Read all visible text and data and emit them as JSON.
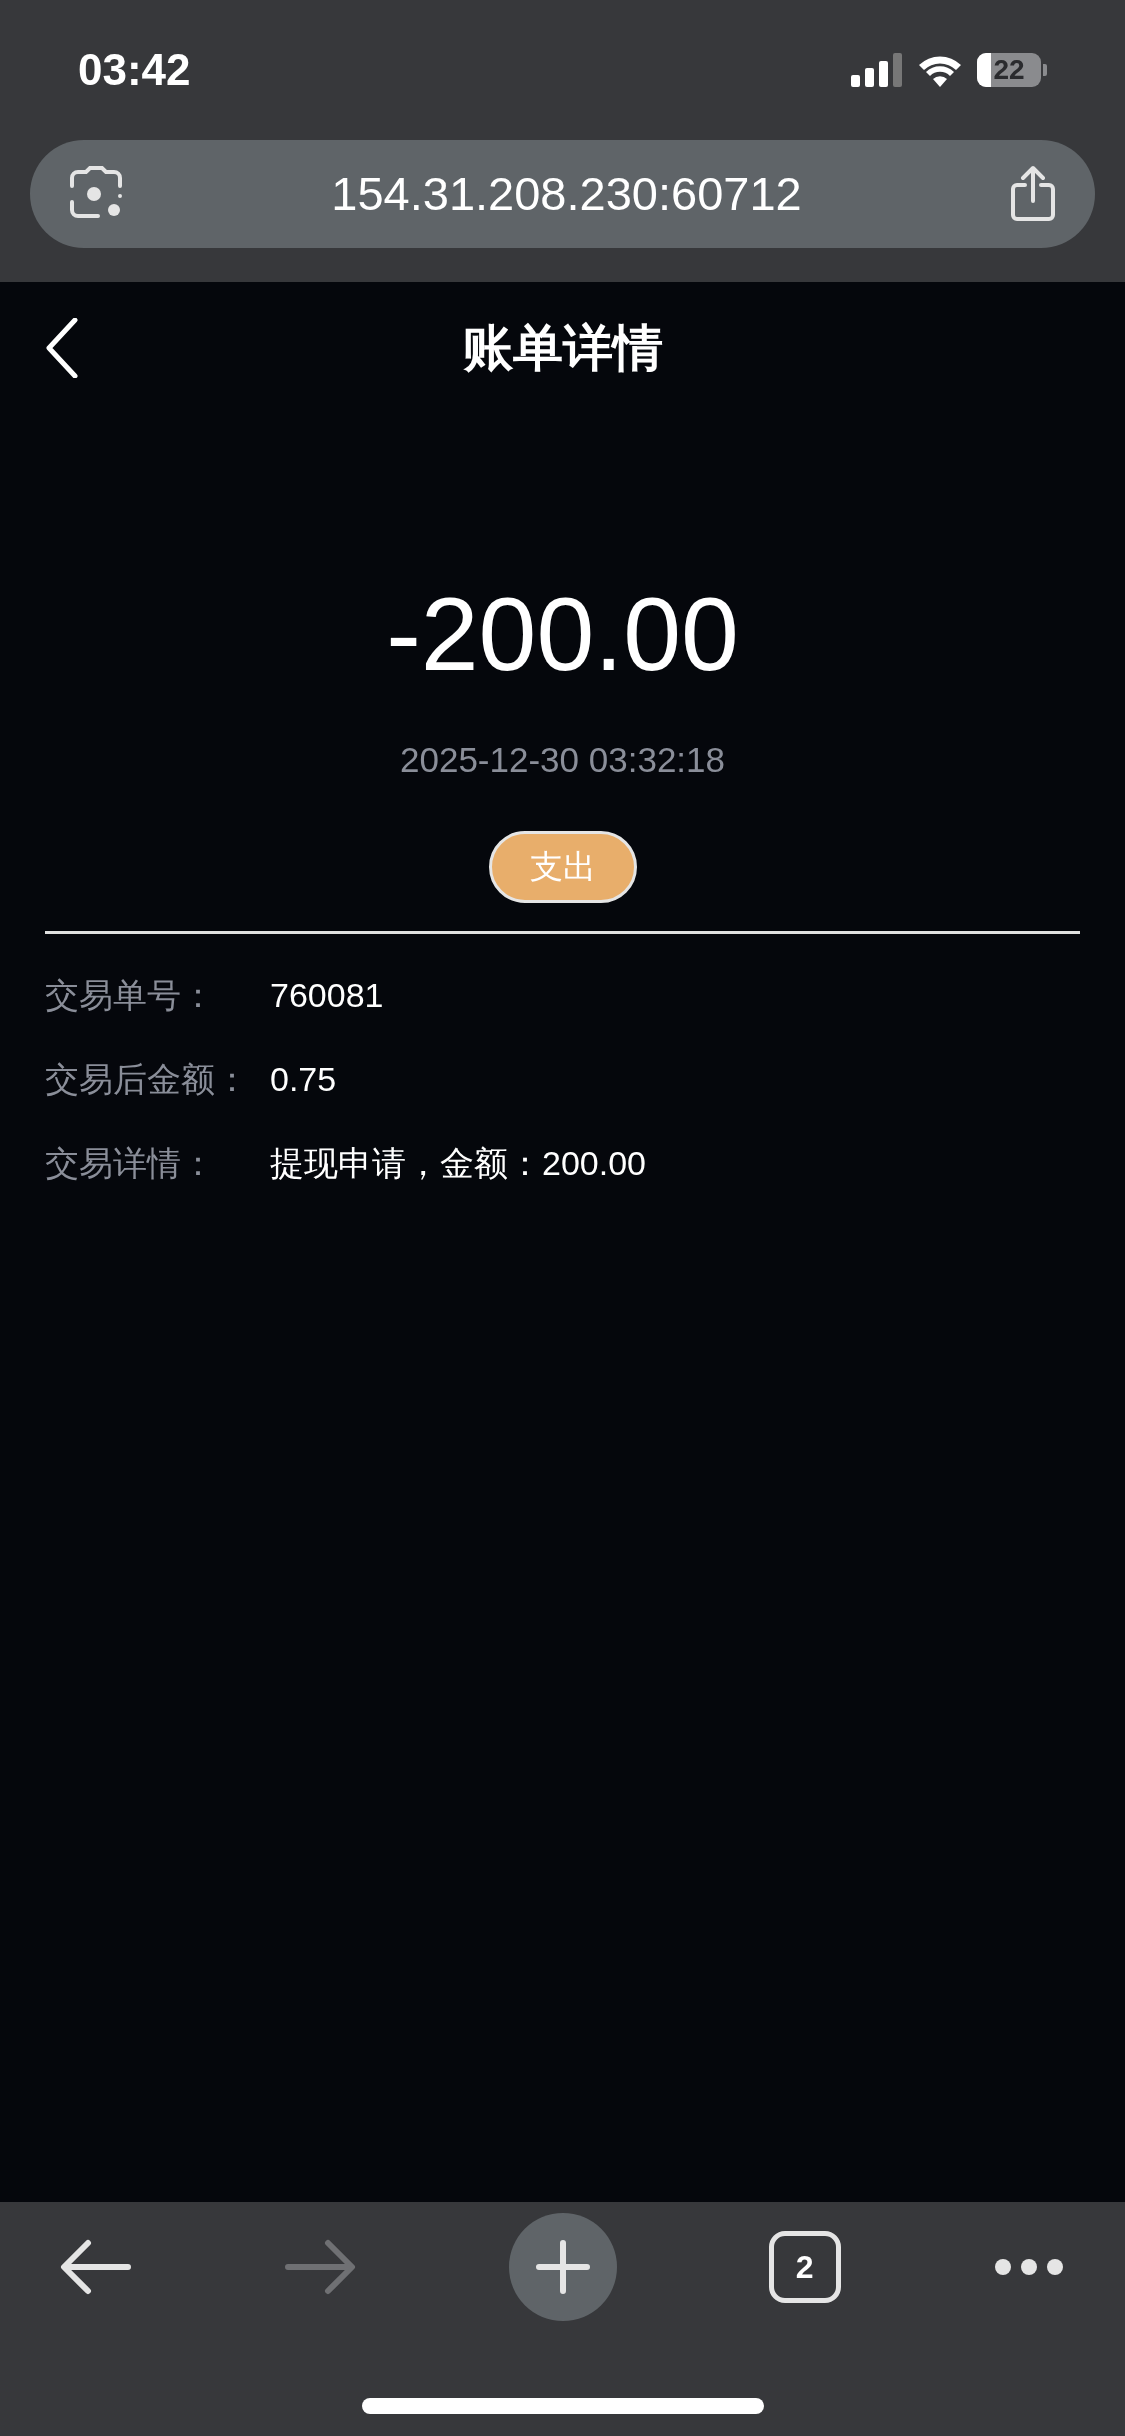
{
  "status_bar": {
    "time": "03:42",
    "battery": "22"
  },
  "address_bar": {
    "url": "154.31.208.230:60712"
  },
  "header": {
    "title": "账单详情"
  },
  "amount": "-200.00",
  "datetime": "2025-12-30 03:32:18",
  "type_badge": "支出",
  "details": [
    {
      "label": "交易单号：",
      "value": "760081"
    },
    {
      "label": "交易后金额：",
      "value": "0.75"
    },
    {
      "label": "交易详情：",
      "value": "提现申请，金额：200.00"
    }
  ],
  "toolbar": {
    "tab_count": "2",
    "forward_disabled": true
  }
}
